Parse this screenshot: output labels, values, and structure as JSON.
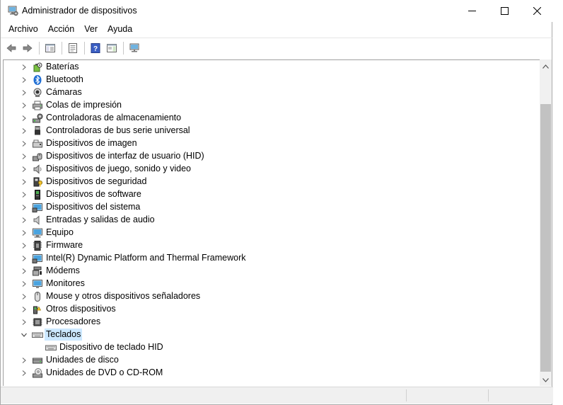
{
  "window": {
    "title": "Administrador de dispositivos",
    "icon": "device-manager-icon"
  },
  "menu": {
    "items": [
      "Archivo",
      "Acción",
      "Ver",
      "Ayuda"
    ]
  },
  "toolbar": {
    "buttons": [
      "back-arrow-icon",
      "forward-arrow-icon",
      "show-hide-console-tree-icon",
      "properties-icon",
      "help-icon",
      "action-pane-icon",
      "scan-hardware-icon"
    ]
  },
  "tree": {
    "nodes": [
      {
        "label": "Baterías",
        "icon": "battery-icon",
        "expanded": false
      },
      {
        "label": "Bluetooth",
        "icon": "bluetooth-icon",
        "expanded": false
      },
      {
        "label": "Cámaras",
        "icon": "camera-icon",
        "expanded": false
      },
      {
        "label": "Colas de impresión",
        "icon": "printer-icon",
        "expanded": false
      },
      {
        "label": "Controladoras de almacenamiento",
        "icon": "storage-controller-icon",
        "expanded": false
      },
      {
        "label": "Controladoras de bus serie universal",
        "icon": "usb-icon",
        "expanded": false
      },
      {
        "label": "Dispositivos de imagen",
        "icon": "imaging-device-icon",
        "expanded": false
      },
      {
        "label": "Dispositivos de interfaz de usuario (HID)",
        "icon": "hid-icon",
        "expanded": false
      },
      {
        "label": "Dispositivos de juego, sonido y video",
        "icon": "speaker-icon",
        "expanded": false
      },
      {
        "label": "Dispositivos de seguridad",
        "icon": "security-device-icon",
        "expanded": false
      },
      {
        "label": "Dispositivos de software",
        "icon": "software-device-icon",
        "expanded": false
      },
      {
        "label": "Dispositivos del sistema",
        "icon": "system-device-icon",
        "expanded": false
      },
      {
        "label": "Entradas y salidas de audio",
        "icon": "audio-io-icon",
        "expanded": false
      },
      {
        "label": "Equipo",
        "icon": "computer-icon",
        "expanded": false
      },
      {
        "label": "Firmware",
        "icon": "firmware-icon",
        "expanded": false
      },
      {
        "label": "Intel(R) Dynamic Platform and Thermal Framework",
        "icon": "system-device-icon",
        "expanded": false
      },
      {
        "label": "Módems",
        "icon": "modem-icon",
        "expanded": false
      },
      {
        "label": "Monitores",
        "icon": "monitor-icon",
        "expanded": false
      },
      {
        "label": "Mouse y otros dispositivos señaladores",
        "icon": "mouse-icon",
        "expanded": false
      },
      {
        "label": "Otros dispositivos",
        "icon": "other-device-icon",
        "expanded": false
      },
      {
        "label": "Procesadores",
        "icon": "processor-icon",
        "expanded": false
      },
      {
        "label": "Teclados",
        "icon": "keyboard-icon",
        "expanded": true,
        "selected": true
      },
      {
        "label": "Dispositivo de teclado HID",
        "icon": "keyboard-icon",
        "child": true
      },
      {
        "label": "Unidades de disco",
        "icon": "disk-drive-icon",
        "expanded": false
      },
      {
        "label": "Unidades de DVD o CD-ROM",
        "icon": "dvd-drive-icon",
        "expanded": false
      }
    ]
  },
  "colors": {
    "selection": "#cce8ff",
    "scroll_track": "#f0f0f0",
    "scroll_thumb": "#c2c2c2"
  }
}
